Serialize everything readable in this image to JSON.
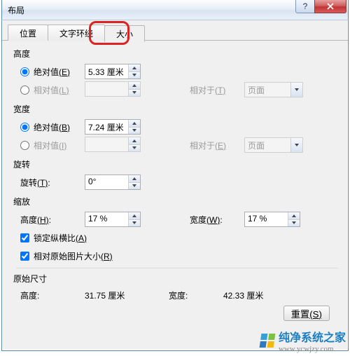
{
  "window": {
    "title": "布局"
  },
  "tabs": [
    {
      "label": "位置"
    },
    {
      "label": "文字环绕"
    },
    {
      "label": "大小",
      "active": true
    }
  ],
  "groups": {
    "height": {
      "title": "高度",
      "abs_label": "绝对值",
      "abs_key": "(E)",
      "abs_value": "5.33 厘米",
      "rel_label": "相对值",
      "rel_key": "(L)",
      "rel_to_label": "相对于",
      "rel_to_key": "(T)",
      "rel_to_value": "页面"
    },
    "width": {
      "title": "宽度",
      "abs_label": "绝对值",
      "abs_key": "(B)",
      "abs_value": "7.24 厘米",
      "rel_label": "相对值",
      "rel_key": "(I)",
      "rel_to_label": "相对于",
      "rel_to_key": "(E)",
      "rel_to_value": "页面"
    },
    "rotate": {
      "title": "旋转",
      "label": "旋转",
      "key": "(T)",
      "value": "0°"
    },
    "scale": {
      "title": "缩放",
      "h_label": "高度",
      "h_key": "(H)",
      "h_value": "17 %",
      "w_label": "宽度",
      "w_key": "(W)",
      "w_value": "17 %",
      "lock_label": "锁定纵横比",
      "lock_key": "(A)",
      "orig_label": "相对原始图片大小",
      "orig_key": "(R)"
    },
    "original": {
      "title": "原始尺寸",
      "h_label": "高度:",
      "h_value": "31.75 厘米",
      "w_label": "宽度:",
      "w_value": "42.33 厘米"
    }
  },
  "buttons": {
    "reset": "重置",
    "reset_key": "(S)"
  },
  "watermark": {
    "text": "纯净系统之家",
    "url": "www.ycwjzy.com"
  }
}
